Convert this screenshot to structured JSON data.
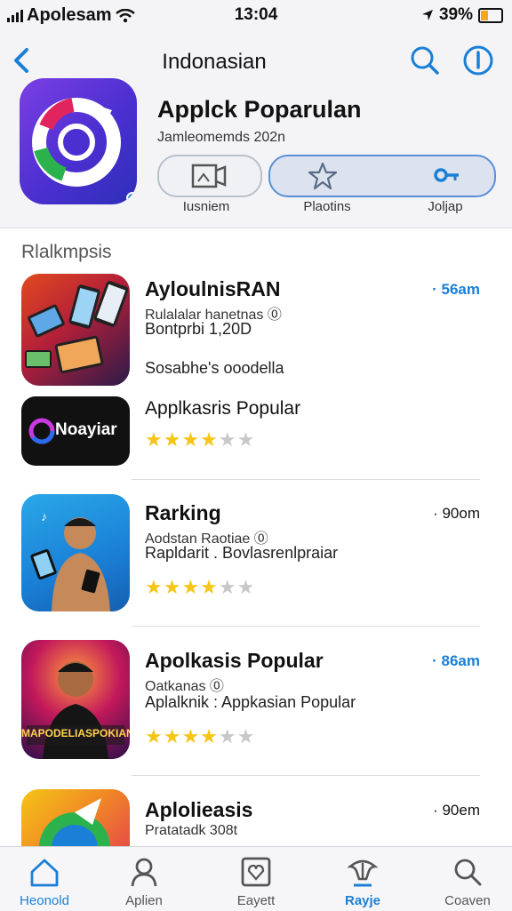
{
  "status": {
    "carrier": "Apolesam",
    "time": "13:04",
    "battery": "39%",
    "battery_level": 0.39
  },
  "header": {
    "nav_title": "Indonasian"
  },
  "app": {
    "title": "Applck Poparulan",
    "subtitle": "Jamleomemds 202n",
    "buttons": [
      {
        "label": "Iusniem",
        "icon": "media-icon"
      },
      {
        "label": "Plaotins",
        "icon": "star-icon"
      },
      {
        "label": "Joljap",
        "icon": "key-icon"
      }
    ]
  },
  "section": {
    "title": "Rlalkmpsis"
  },
  "list": [
    {
      "title": "AyloulnisRAN",
      "line1": "Rulalalar hanetnas ⓪",
      "line2": "Bontprbi 1,20D",
      "line3": "Sosabhe's ooodella",
      "size": "· 56am",
      "size_color": "#1a7fd6"
    },
    {
      "title": "Applkasris Popular",
      "thumb_text": "Noayiar",
      "rating": 3.5
    },
    {
      "title": "Rarking",
      "line1": "Aodstan Raotiae ⓪",
      "line2": "Rapldarit  .  Bovlasrenlpraiar",
      "size": "· 90om",
      "rating": 3.5
    },
    {
      "title": "Apolkasis Popular",
      "line1": "Oatkanas ⓪",
      "line2": "Aplalknik  :  Appkasian Popular",
      "size": "· 86am",
      "size_color": "#1a7fd6",
      "thumb_text": "MAPODELIASPOKIAN",
      "rating": 3.5
    },
    {
      "title": "Aplolieasis",
      "line1": "Pratatadk 308t",
      "size": "· 90em"
    }
  ],
  "tabs": [
    {
      "label": "Heonold",
      "icon": "home-icon"
    },
    {
      "label": "Aplien",
      "icon": "person-icon"
    },
    {
      "label": "Eayett",
      "icon": "heart-box-icon"
    },
    {
      "label": "Rayje",
      "icon": "gift-icon"
    },
    {
      "label": "Coaven",
      "icon": "search-icon"
    }
  ]
}
